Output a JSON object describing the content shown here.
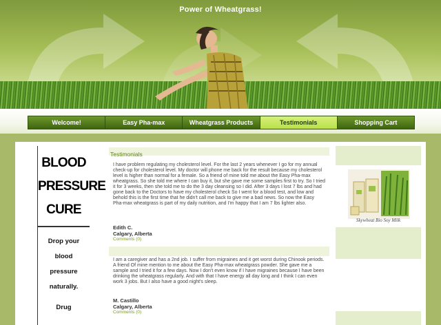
{
  "header": {
    "title": "Power of Wheatgrass!"
  },
  "nav": {
    "items": [
      {
        "label": "Welcome!"
      },
      {
        "label": "Easy Pha-max"
      },
      {
        "label": "Wheatgrass Products"
      },
      {
        "label": "Testimonials",
        "active": true
      },
      {
        "label": "Shopping Cart"
      }
    ]
  },
  "left": {
    "line1": "BLOOD",
    "line2": "PRESSURE",
    "line3": "CURE",
    "s1": "Drop your",
    "s2": "blood",
    "s3": "pressure",
    "s4": "naturally.",
    "s5": "Drug"
  },
  "main": {
    "heading": "Testimonials",
    "t1": "I have problem regulating my cholesterol level. For the last 2 years whenever I go for my annual check-up for cholesterol level. My doctor will phone me back for the result because my cholesterol level is higher than normal for a female. So a friend of mine told me about the Easy Pha-max wheatgrass. So she told me where I can buy it, but she gave me some samples first to try. So I tried it for 3 weeks, then she told me to do the 3 day cleansing so I did. After 3 days I lost 7 lbs and had gone back to the Doctors to have my cholesterol check So I went for a blood test, and low and behold this is the first time that he didn't call me back to give me a bad news. So now the Easy Pha-max wheatgrass is part of my daily nutrition, and I'm happy that I am 7 lbs lighter also.",
    "n1": "Edith C.",
    "l1": "Calgary, Alberta",
    "c1": "Comments (0)",
    "t2": "I am a caregiver and has a 2nd job. I suffer from migraines and it get worst during Chinook periods. A friend Of mine mention to me about the Easy Pha-max wheatgrass powder. She gave me a sample and I tried it for a few days. Now I don't even know if I have migraines because I have been drinking the wheatgrass regularly. And with that I have energy all day long and I think I can even work 3 jobs. But I also have a good night's sleep.",
    "n2": "M. Castillo",
    "l2": "Calgary, Alberta",
    "c2": "Comments (0)"
  },
  "right": {
    "caption": "Skywheat Bio Soy Milk"
  },
  "colors": {
    "nav": "#557e1c",
    "nav_active": "#c8e85a",
    "accent": "#5e7f1c"
  }
}
